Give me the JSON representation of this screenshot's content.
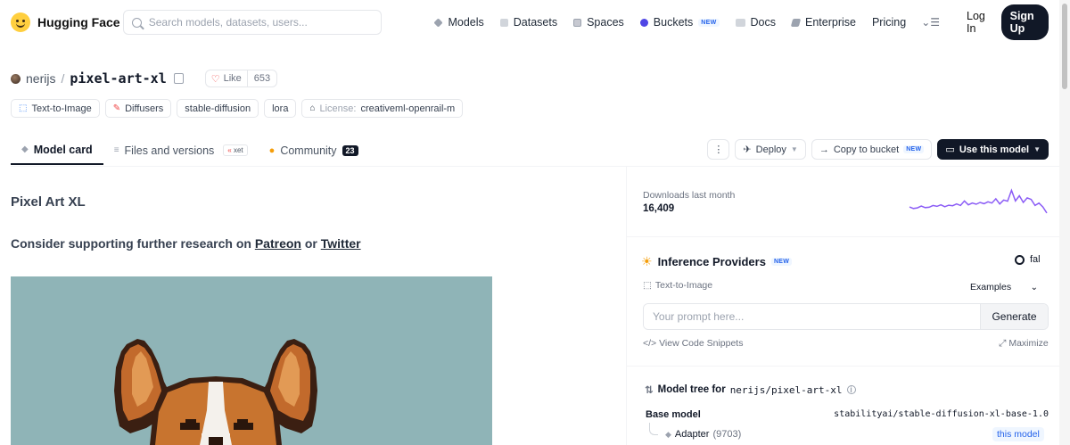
{
  "brand": {
    "name": "Hugging Face"
  },
  "search": {
    "placeholder": "Search models, datasets, users..."
  },
  "nav": {
    "items": [
      {
        "label": "Models",
        "icon": "cube-icon",
        "color": "#9ca3af"
      },
      {
        "label": "Datasets",
        "icon": "database-icon",
        "color": "#9ca3af"
      },
      {
        "label": "Spaces",
        "icon": "grid-icon",
        "color": "#9ca3af"
      },
      {
        "label": "Buckets",
        "icon": "bucket-icon",
        "color": "#4f46e5",
        "badge": "NEW"
      },
      {
        "label": "Docs",
        "icon": "book-icon",
        "color": "#9ca3af"
      },
      {
        "label": "Enterprise",
        "icon": "enterprise-icon",
        "color": "#9ca3af"
      },
      {
        "label": "Pricing",
        "icon": "",
        "color": ""
      }
    ],
    "login": "Log In",
    "signup": "Sign Up"
  },
  "repo": {
    "owner": "nerijs",
    "slash": "/",
    "name": "pixel-art-xl",
    "like_label": "Like",
    "like_count": "653"
  },
  "tags": [
    {
      "label": "Text-to-Image",
      "icon": "text-to-image-icon"
    },
    {
      "label": "Diffusers",
      "icon": "diffusers-icon"
    },
    {
      "label": "stable-diffusion",
      "icon": ""
    },
    {
      "label": "lora",
      "icon": ""
    },
    {
      "prefix": "License:",
      "label": "creativeml-openrail-m",
      "icon": "license-icon"
    }
  ],
  "tabs": [
    {
      "label": "Model card",
      "active": true
    },
    {
      "label": "Files and versions",
      "badge": "xet"
    },
    {
      "label": "Community",
      "count": "23"
    }
  ],
  "actions": {
    "deploy": "Deploy",
    "copy_bucket": "Copy to bucket",
    "copy_bucket_badge": "NEW",
    "use_model": "Use this model"
  },
  "card": {
    "title": "Pixel Art XL",
    "support_prefix": "Consider supporting further research on",
    "support_link1": "Patreon",
    "support_mid": "or",
    "support_link2": "Twitter"
  },
  "downloads": {
    "label": "Downloads last month",
    "value": "16,409",
    "trend": [
      0.35,
      0.3,
      0.32,
      0.38,
      0.33,
      0.34,
      0.4,
      0.37,
      0.42,
      0.36,
      0.41,
      0.39,
      0.45,
      0.4,
      0.55,
      0.42,
      0.48,
      0.44,
      0.5,
      0.46,
      0.52,
      0.48,
      0.62,
      0.45,
      0.58,
      0.54,
      0.9,
      0.55,
      0.72,
      0.5,
      0.65,
      0.6,
      0.4,
      0.48,
      0.35,
      0.15
    ],
    "line_color": "#8b5cf6"
  },
  "inference": {
    "title": "Inference Providers",
    "badge": "NEW",
    "provider": "fal",
    "task": "Text-to-Image",
    "examples": "Examples",
    "prompt_placeholder": "Your prompt here...",
    "generate": "Generate",
    "snippets": "View Code Snippets",
    "maximize": "Maximize"
  },
  "tree": {
    "title_prefix": "Model tree for",
    "title_repo": "nerijs/pixel-art-xl",
    "base_label": "Base model",
    "base_value": "stabilityai/stable-diffusion-xl-base-1.0",
    "adapter_label": "Adapter",
    "adapter_count": "(9703)",
    "this_model": "this model"
  }
}
